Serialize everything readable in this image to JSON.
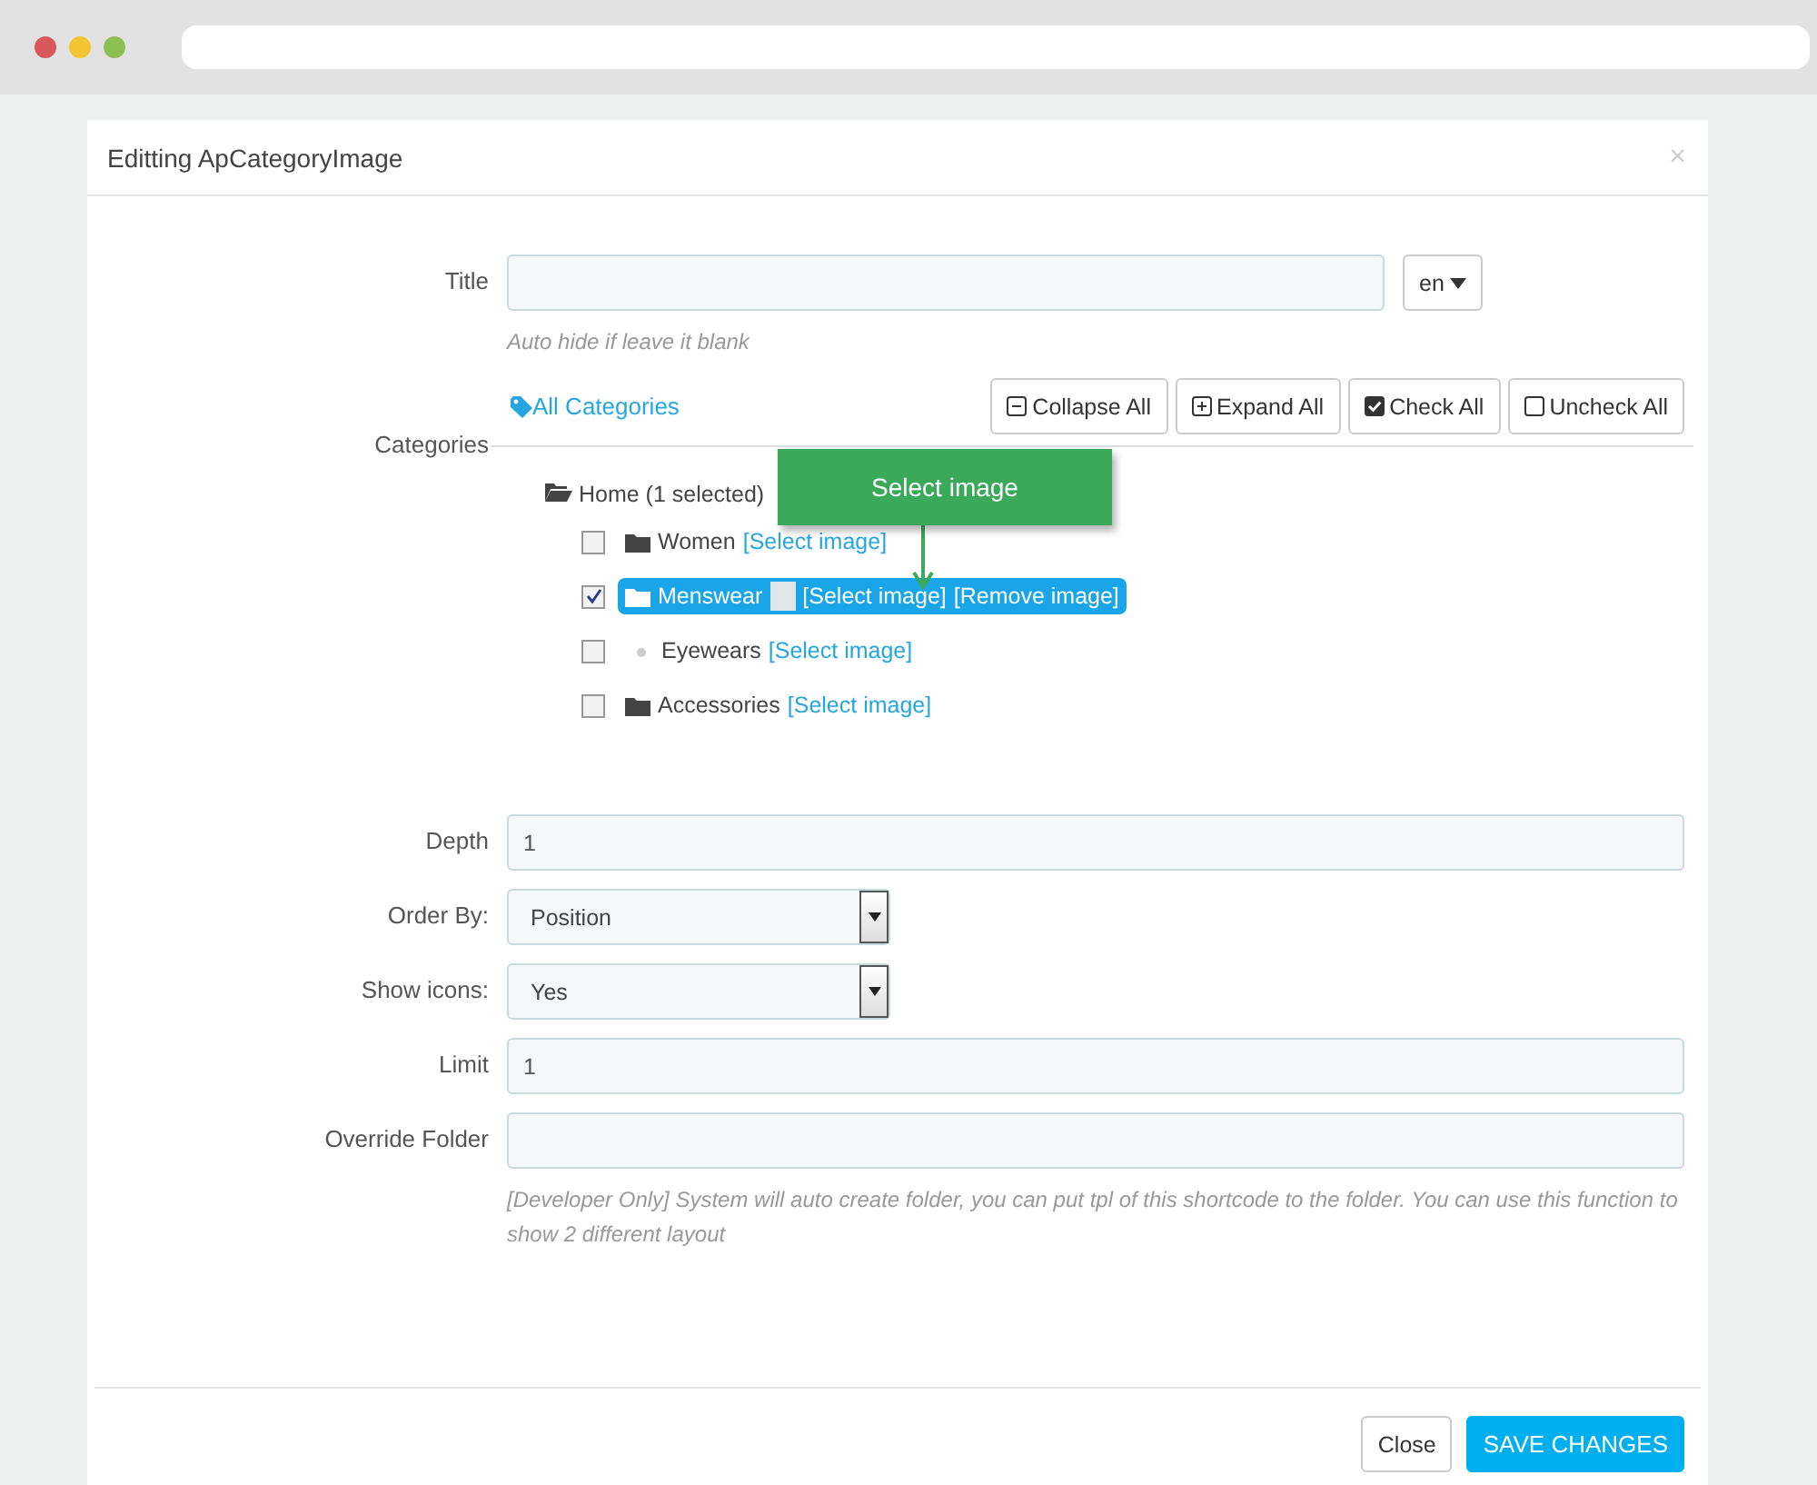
{
  "modal": {
    "title": "Editting ApCategoryImage",
    "close": "×"
  },
  "title_field": {
    "label": "Title",
    "language": "en",
    "help": "Auto hide if leave it blank"
  },
  "categories": {
    "label": "Categories",
    "all_link": "All Categories",
    "buttons": [
      {
        "kind": "collapse",
        "label": "Collapse All"
      },
      {
        "kind": "expand",
        "label": "Expand All"
      },
      {
        "kind": "check",
        "label": "Check All"
      },
      {
        "kind": "uncheck",
        "label": "Uncheck All"
      }
    ],
    "tree": {
      "label": "Home (1 selected)",
      "expanded": true,
      "children": [
        {
          "kind": "folder",
          "label": "Women",
          "checked": false,
          "selected": false,
          "image": false,
          "links": [
            "[Select image]"
          ]
        },
        {
          "kind": "folder",
          "label": "Menswear",
          "checked": true,
          "selected": true,
          "image": true,
          "links": [
            "[Select image]",
            "[Remove image]"
          ]
        },
        {
          "kind": "leaf",
          "label": "Eyewears",
          "checked": false,
          "selected": false,
          "image": false,
          "links": [
            "[Select image]"
          ]
        },
        {
          "kind": "folder",
          "label": "Accessories",
          "checked": false,
          "selected": false,
          "image": false,
          "links": [
            "[Select image]"
          ]
        }
      ]
    },
    "callout": "Select image"
  },
  "fields": [
    {
      "kind": "text",
      "label": "Depth",
      "value": "1"
    },
    {
      "kind": "select",
      "label": "Order By:",
      "value": "Position"
    },
    {
      "kind": "select",
      "label": "Show icons:",
      "value": "Yes"
    },
    {
      "kind": "text",
      "label": "Limit",
      "value": "1"
    },
    {
      "kind": "text",
      "label": "Override Folder",
      "help": "[Developer Only] System will auto create folder, you can put tpl of this shortcode to the folder. You can use this function to show 2 different layout"
    }
  ],
  "footer": {
    "buttons": [
      {
        "kind": "default",
        "label": "Close"
      },
      {
        "kind": "primary",
        "label": "SAVE CHANGES"
      }
    ]
  }
}
